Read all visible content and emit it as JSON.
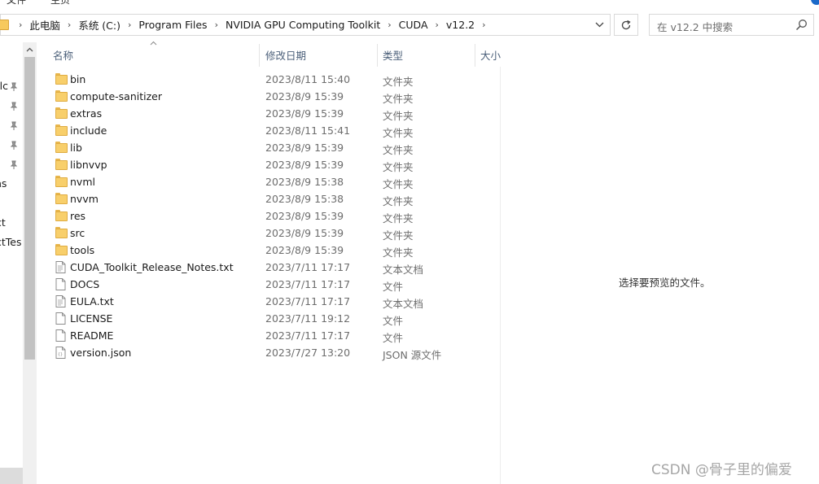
{
  "menu": {
    "items": [
      "文件",
      "主页"
    ]
  },
  "address_bar": {
    "crumbs": [
      "此电脑",
      "系统 (C:)",
      "Program Files",
      "NVIDIA GPU Computing Toolkit",
      "CUDA",
      "v12.2"
    ]
  },
  "search": {
    "placeholder": "在 v12.2 中搜索"
  },
  "nav_pane": {
    "items": [
      "alc",
      "ns",
      "ct",
      "ctTes"
    ]
  },
  "columns": {
    "name": "名称",
    "date": "修改日期",
    "type": "类型",
    "size": "大小"
  },
  "files": [
    {
      "name": "bin",
      "date": "2023/8/11 15:40",
      "type": "文件夹",
      "icon": "folder-icon"
    },
    {
      "name": "compute-sanitizer",
      "date": "2023/8/9 15:39",
      "type": "文件夹",
      "icon": "folder-icon"
    },
    {
      "name": "extras",
      "date": "2023/8/9 15:39",
      "type": "文件夹",
      "icon": "folder-icon"
    },
    {
      "name": "include",
      "date": "2023/8/11 15:41",
      "type": "文件夹",
      "icon": "folder-icon"
    },
    {
      "name": "lib",
      "date": "2023/8/9 15:39",
      "type": "文件夹",
      "icon": "folder-icon"
    },
    {
      "name": "libnvvp",
      "date": "2023/8/9 15:39",
      "type": "文件夹",
      "icon": "folder-icon"
    },
    {
      "name": "nvml",
      "date": "2023/8/9 15:38",
      "type": "文件夹",
      "icon": "folder-icon"
    },
    {
      "name": "nvvm",
      "date": "2023/8/9 15:38",
      "type": "文件夹",
      "icon": "folder-icon"
    },
    {
      "name": "res",
      "date": "2023/8/9 15:39",
      "type": "文件夹",
      "icon": "folder-icon"
    },
    {
      "name": "src",
      "date": "2023/8/9 15:39",
      "type": "文件夹",
      "icon": "folder-icon"
    },
    {
      "name": "tools",
      "date": "2023/8/9 15:39",
      "type": "文件夹",
      "icon": "folder-icon"
    },
    {
      "name": "CUDA_Toolkit_Release_Notes.txt",
      "date": "2023/7/11 17:17",
      "type": "文本文档",
      "icon": "text-file-icon"
    },
    {
      "name": "DOCS",
      "date": "2023/7/11 17:17",
      "type": "文件",
      "icon": "file-icon"
    },
    {
      "name": "EULA.txt",
      "date": "2023/7/11 17:17",
      "type": "文本文档",
      "icon": "text-file-icon"
    },
    {
      "name": "LICENSE",
      "date": "2023/7/11 19:12",
      "type": "文件",
      "icon": "file-icon"
    },
    {
      "name": "README",
      "date": "2023/7/11 17:17",
      "type": "文件",
      "icon": "file-icon"
    },
    {
      "name": "version.json",
      "date": "2023/7/27 13:20",
      "type": "JSON 源文件",
      "icon": "json-file-icon"
    }
  ],
  "preview": {
    "message": "选择要预览的文件。"
  },
  "watermark": "CSDN @骨子里的偏爱"
}
